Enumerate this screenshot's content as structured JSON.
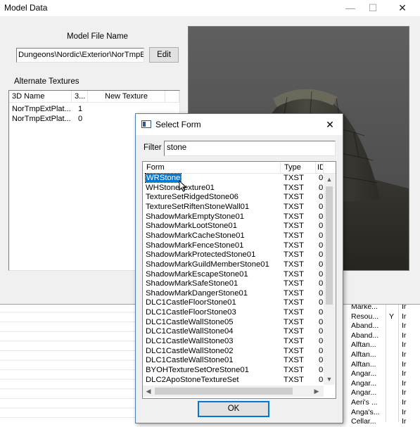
{
  "model_window": {
    "title": "Model Data",
    "file_name_label": "Model File Name",
    "file_name_value": "Dungeons\\Nordic\\Exterior\\NorTmpE:",
    "edit_label": "Edit",
    "alt_textures_label": "Alternate Textures",
    "table": {
      "headers": [
        "3D Name",
        "3...",
        "New Texture"
      ],
      "rows": [
        {
          "name": "NorTmpExtPlat...",
          "index": "1",
          "texture": ""
        },
        {
          "name": "NorTmpExtPlat...",
          "index": "0",
          "texture": ""
        }
      ]
    }
  },
  "select_form": {
    "title": "Select Form",
    "filter_label": "Filter",
    "filter_value": "stone",
    "headers": [
      "Form",
      "Type",
      "ID"
    ],
    "selected_index": 0,
    "rows": [
      {
        "form": "WRStone",
        "type": "TXST",
        "id": "0"
      },
      {
        "form": "WHStoneTexture01",
        "type": "TXST",
        "id": "0"
      },
      {
        "form": "TextureSetRidgedStone06",
        "type": "TXST",
        "id": "0"
      },
      {
        "form": "TextureSetRiftenStoneWall01",
        "type": "TXST",
        "id": "0"
      },
      {
        "form": "ShadowMarkEmptyStone01",
        "type": "TXST",
        "id": "0"
      },
      {
        "form": "ShadowMarkLootStone01",
        "type": "TXST",
        "id": "0"
      },
      {
        "form": "ShadowMarkCacheStone01",
        "type": "TXST",
        "id": "0"
      },
      {
        "form": "ShadowMarkFenceStone01",
        "type": "TXST",
        "id": "0"
      },
      {
        "form": "ShadowMarkProtectedStone01",
        "type": "TXST",
        "id": "0"
      },
      {
        "form": "ShadowMarkGuildMemberStone01",
        "type": "TXST",
        "id": "0"
      },
      {
        "form": "ShadowMarkEscapeStone01",
        "type": "TXST",
        "id": "0"
      },
      {
        "form": "ShadowMarkSafeStone01",
        "type": "TXST",
        "id": "0"
      },
      {
        "form": "ShadowMarkDangerStone01",
        "type": "TXST",
        "id": "0"
      },
      {
        "form": "DLC1CastleFloorStone01",
        "type": "TXST",
        "id": "0"
      },
      {
        "form": "DLC1CastleFloorStone03",
        "type": "TXST",
        "id": "0"
      },
      {
        "form": "DLC1CastleWallStone05",
        "type": "TXST",
        "id": "0"
      },
      {
        "form": "DLC1CastleWallStone04",
        "type": "TXST",
        "id": "0"
      },
      {
        "form": "DLC1CastleWallStone03",
        "type": "TXST",
        "id": "0"
      },
      {
        "form": "DLC1CastleWallStone02",
        "type": "TXST",
        "id": "0"
      },
      {
        "form": "DLC1CastleWallStone01",
        "type": "TXST",
        "id": "0"
      },
      {
        "form": "BYOHTextureSetOreStone01",
        "type": "TXST",
        "id": "0"
      },
      {
        "form": "DLC2ApoStoneTextureSet",
        "type": "TXST",
        "id": "0"
      }
    ],
    "ok_label": "OK"
  },
  "background_list": {
    "rows": [
      {
        "a": "Marke...",
        "b": "",
        "c": "Ir"
      },
      {
        "a": "Resou...",
        "b": "Y",
        "c": "Ir"
      },
      {
        "a": "Aband...",
        "b": "",
        "c": "Ir"
      },
      {
        "a": "Aband...",
        "b": "",
        "c": "Ir"
      },
      {
        "a": "Alftan...",
        "b": "",
        "c": "Ir"
      },
      {
        "a": "Alftan...",
        "b": "",
        "c": "Ir"
      },
      {
        "a": "Alftan...",
        "b": "",
        "c": "Ir"
      },
      {
        "a": "Angar...",
        "b": "",
        "c": "Ir"
      },
      {
        "a": "Angar...",
        "b": "",
        "c": "Ir"
      },
      {
        "a": "Angar...",
        "b": "",
        "c": "Ir"
      },
      {
        "a": "Aeri's ...",
        "b": "",
        "c": "Ir"
      },
      {
        "a": "Anga's...",
        "b": "",
        "c": "Ir"
      },
      {
        "a": "Cellar...",
        "b": "",
        "c": "Ir"
      }
    ]
  },
  "colors": {
    "selection": "#0078d7",
    "dialog_border": "#4a7ebb",
    "preview_bg": "#555555"
  }
}
